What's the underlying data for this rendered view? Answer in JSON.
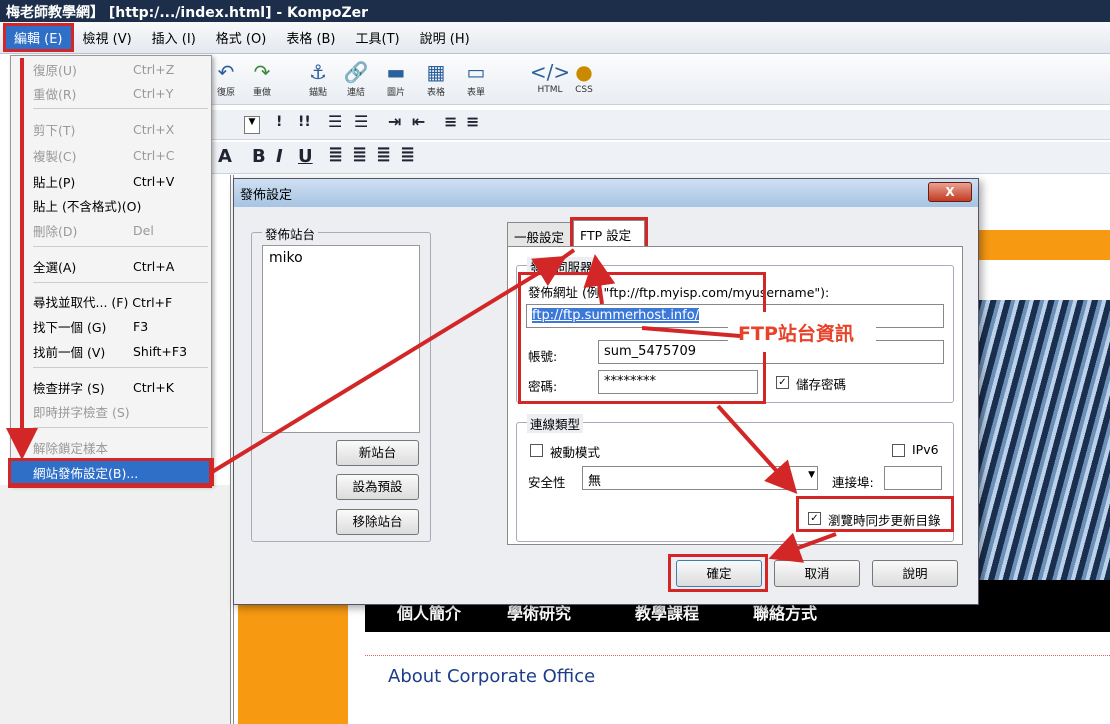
{
  "window": {
    "title": "梅老師教學網】 [http:/.../index.html] - KompoZer"
  },
  "menubar": {
    "items": [
      {
        "label": "編輯 (E)"
      },
      {
        "label": "檢視 (V)"
      },
      {
        "label": "插入 (I)"
      },
      {
        "label": "格式 (O)"
      },
      {
        "label": "表格 (B)"
      },
      {
        "label": "工具(T)"
      },
      {
        "label": "說明 (H)"
      }
    ]
  },
  "toolbar": {
    "undo": "復原",
    "redo": "重做",
    "anchor": "錨點",
    "link": "連結",
    "image": "圖片",
    "table": "表格",
    "form": "表單",
    "html": "HTML",
    "css": "CSS"
  },
  "format_toolbar": {
    "a": "A",
    "b": "B",
    "i": "I",
    "u": "U",
    "b1": "!",
    "b2": "!!"
  },
  "edit_menu": {
    "undo": {
      "label": "復原(U)",
      "shortcut": "Ctrl+Z"
    },
    "redo": {
      "label": "重做(R)",
      "shortcut": "Ctrl+Y"
    },
    "cut": {
      "label": "剪下(T)",
      "shortcut": "Ctrl+X"
    },
    "copy": {
      "label": "複製(C)",
      "shortcut": "Ctrl+C"
    },
    "paste": {
      "label": "貼上(P)",
      "shortcut": "Ctrl+V"
    },
    "paste_plain": {
      "label": "貼上 (不含格式)(O)"
    },
    "delete": {
      "label": "刪除(D)",
      "shortcut": "Del"
    },
    "select_all": {
      "label": "全選(A)",
      "shortcut": "Ctrl+A"
    },
    "find_replace": {
      "label": "尋找並取代... (F) Ctrl+F"
    },
    "find_next": {
      "label": "找下一個 (G)",
      "shortcut": "F3"
    },
    "find_prev": {
      "label": "找前一個 (V)",
      "shortcut": "Shift+F3"
    },
    "spellcheck": {
      "label": "檢查拼字 (S)",
      "shortcut": "Ctrl+K"
    },
    "live_spell": {
      "label": "即時拼字檢查 (S)"
    },
    "unlock": {
      "label": "解除鎖定樣本"
    },
    "publish_settings": {
      "label": "網站發佈設定(B)..."
    }
  },
  "dialog": {
    "title": "發佈設定",
    "close": "X",
    "sites_group": "發佈站台",
    "sites": [
      "miko"
    ],
    "new_site": "新站台",
    "set_default": "設為預設",
    "remove_site": "移除站台",
    "tab_general": "一般設定",
    "tab_ftp": "FTP 設定",
    "server_group": "發佈伺服器",
    "publish_url_label": "發佈網址 (例:\"ftp://ftp.myisp.com/myusername\"):",
    "publish_url": "ftp://ftp.summerhost.info/",
    "username_label": "帳號:",
    "username": "sum_5475709",
    "password_label": "密碼:",
    "password": "********",
    "save_password": "儲存密碼",
    "conn_group": "連線類型",
    "passive_mode": "被動模式",
    "ipv6": "IPv6",
    "security_label": "安全性",
    "security_value": "無",
    "port_label": "連接埠:",
    "sync_dirs": "瀏覽時同步更新目錄",
    "ok": "確定",
    "cancel": "取消",
    "help": "說明"
  },
  "annotation": {
    "ftp_info": "FTP站台資訊"
  },
  "page": {
    "nav": [
      "個人簡介",
      "學術研究",
      "教學課程",
      "聯絡方式"
    ],
    "about": "About Corporate Office"
  },
  "colors": {
    "accent_red": "#d32626",
    "orange": "#f79a12",
    "selection_blue": "#2f6fc8"
  }
}
